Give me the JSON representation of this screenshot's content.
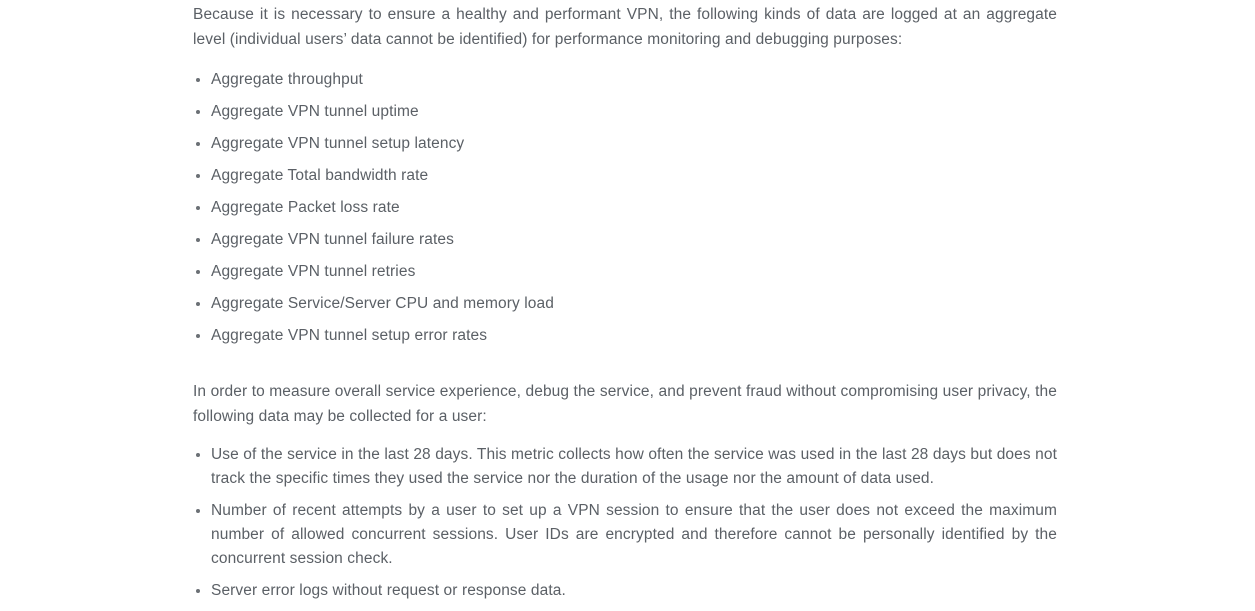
{
  "document": {
    "background_color": "#ffffff",
    "text_color": "#5b6066",
    "bullet_color": "#6b7075",
    "paragraphs": {
      "intro": "Because it is necessary to ensure a healthy and performant VPN, the following kinds of data are logged at an aggregate level (individual users’ data cannot be identified) for performance monitoring and debugging purposes:",
      "second": "In order to measure overall service experience, debug the service, and prevent fraud without compromising user privacy, the following data may be collected for a user:"
    },
    "aggregate_list": [
      {
        "text": "Aggregate throughput"
      },
      {
        "text": "Aggregate VPN tunnel uptime"
      },
      {
        "text": "Aggregate VPN tunnel setup latency"
      },
      {
        "text": "Aggregate Total bandwidth rate"
      },
      {
        "text": "Aggregate Packet loss rate"
      },
      {
        "text": "Aggregate VPN tunnel failure rates"
      },
      {
        "text": "Aggregate VPN tunnel retries"
      },
      {
        "text": "Aggregate Service/Server CPU and memory load"
      },
      {
        "text": "Aggregate VPN tunnel setup error rates"
      }
    ],
    "user_data_list": [
      {
        "text": "Use of the service in the last 28 days. This metric collects how often the service was used in the last 28 days but does not track the specific times they used the service nor the duration of the usage nor the amount of data used."
      },
      {
        "text": "Number of recent attempts by a user to set up a VPN session to ensure that the user does not exceed the maximum number of allowed concurrent sessions. User IDs are encrypted and therefore cannot be personally identified by the concurrent session check."
      },
      {
        "text": "Server error logs without request or response data."
      }
    ]
  }
}
